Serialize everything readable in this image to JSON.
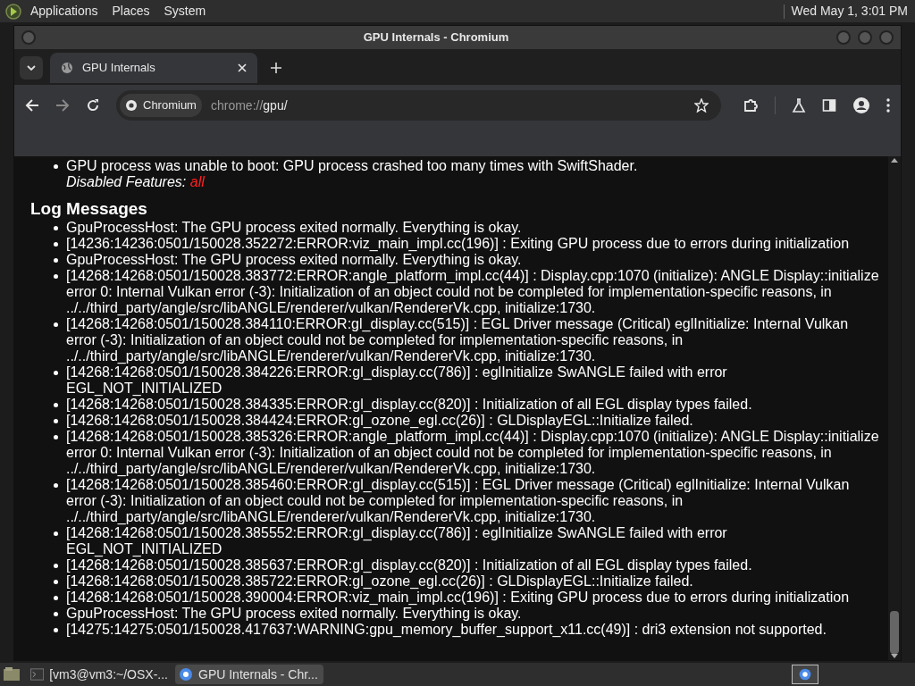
{
  "top_panel": {
    "menus": [
      "Applications",
      "Places",
      "System"
    ],
    "clock": "Wed May 1, 3:01 PM"
  },
  "window": {
    "title": "GPU Internals - Chromium"
  },
  "tabs": [
    {
      "label": "GPU Internals",
      "selected": true
    }
  ],
  "toolbar": {
    "site_chip": "Chromium",
    "url_scheme": "chrome://",
    "url_host": "gpu/"
  },
  "content": {
    "problem_text": "GPU process was unable to boot: GPU process crashed too many times with SwiftShader.",
    "disabled_label": "Disabled Features:",
    "disabled_value": "all",
    "log_heading": "Log Messages",
    "log_messages": [
      "GpuProcessHost: The GPU process exited normally. Everything is okay.",
      "[14236:14236:0501/150028.352272:ERROR:viz_main_impl.cc(196)] : Exiting GPU process due to errors during initialization",
      "GpuProcessHost: The GPU process exited normally. Everything is okay.",
      "[14268:14268:0501/150028.383772:ERROR:angle_platform_impl.cc(44)] : Display.cpp:1070 (initialize): ANGLE Display::initialize error 0: Internal Vulkan error (-3): Initialization of an object could not be completed for implementation-specific reasons, in ../../third_party/angle/src/libANGLE/renderer/vulkan/RendererVk.cpp, initialize:1730.",
      "[14268:14268:0501/150028.384110:ERROR:gl_display.cc(515)] : EGL Driver message (Critical) eglInitialize: Internal Vulkan error (-3): Initialization of an object could not be completed for implementation-specific reasons, in ../../third_party/angle/src/libANGLE/renderer/vulkan/RendererVk.cpp, initialize:1730.",
      "[14268:14268:0501/150028.384226:ERROR:gl_display.cc(786)] : eglInitialize SwANGLE failed with error EGL_NOT_INITIALIZED",
      "[14268:14268:0501/150028.384335:ERROR:gl_display.cc(820)] : Initialization of all EGL display types failed.",
      "[14268:14268:0501/150028.384424:ERROR:gl_ozone_egl.cc(26)] : GLDisplayEGL::Initialize failed.",
      "[14268:14268:0501/150028.385326:ERROR:angle_platform_impl.cc(44)] : Display.cpp:1070 (initialize): ANGLE Display::initialize error 0: Internal Vulkan error (-3): Initialization of an object could not be completed for implementation-specific reasons, in ../../third_party/angle/src/libANGLE/renderer/vulkan/RendererVk.cpp, initialize:1730.",
      "[14268:14268:0501/150028.385460:ERROR:gl_display.cc(515)] : EGL Driver message (Critical) eglInitialize: Internal Vulkan error (-3): Initialization of an object could not be completed for implementation-specific reasons, in ../../third_party/angle/src/libANGLE/renderer/vulkan/RendererVk.cpp, initialize:1730.",
      "[14268:14268:0501/150028.385552:ERROR:gl_display.cc(786)] : eglInitialize SwANGLE failed with error EGL_NOT_INITIALIZED",
      "[14268:14268:0501/150028.385637:ERROR:gl_display.cc(820)] : Initialization of all EGL display types failed.",
      "[14268:14268:0501/150028.385722:ERROR:gl_ozone_egl.cc(26)] : GLDisplayEGL::Initialize failed.",
      "[14268:14268:0501/150028.390004:ERROR:viz_main_impl.cc(196)] : Exiting GPU process due to errors during initialization",
      "GpuProcessHost: The GPU process exited normally. Everything is okay.",
      "[14275:14275:0501/150028.417637:WARNING:gpu_memory_buffer_support_x11.cc(49)] : dri3 extension not supported."
    ]
  },
  "taskbar": {
    "items": [
      {
        "kind": "terminal",
        "label": "[vm3@vm3:~/OSX-...",
        "selected": false
      },
      {
        "kind": "browser",
        "label": "GPU Internals - Chr...",
        "selected": true
      }
    ]
  }
}
